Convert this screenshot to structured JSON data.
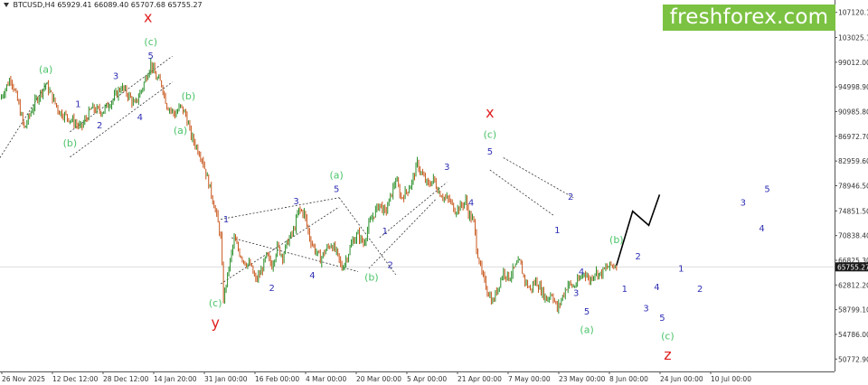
{
  "header": {
    "symbol": "BTCUSD,H4",
    "quote": "65929.41 66089.40 65707.68 65755.27"
  },
  "brand": {
    "name": "freshforex.com"
  },
  "colors": {
    "bull": "#2a8f2a",
    "bear": "#c8561b",
    "wave_minor": "#2f2fb5",
    "wave_intermediate": "#4cc46a",
    "wave_major": "#e02020",
    "current_price": "#1a1a1a",
    "forecast": "#000000"
  },
  "chart_data": {
    "type": "line",
    "title": "",
    "xlabel": "",
    "ylabel": "",
    "ylim": [
      48760,
      109130
    ],
    "y_ticks": [
      "107120.18",
      "103025.16",
      "99012.00",
      "94998.90",
      "90985.80",
      "86972.70",
      "82959.60",
      "78946.50",
      "74851.50",
      "70838.40",
      "66825.30",
      "62812.20",
      "58799.10",
      "54786.00",
      "50772.90"
    ],
    "current_price": "65755.27",
    "x_labels": [
      "26 Nov 2025",
      "12 Dec 12:00",
      "28 Dec 12:00",
      "14 Jan 20:00",
      "31 Jan 00:00",
      "16 Feb 00:00",
      "4 Mar 00:00",
      "20 Mar 00:00",
      "5 Apr 00:00",
      "21 Apr 00:00",
      "7 May 00:00",
      "23 May 00:00",
      "8 Jun 00:00",
      "24 Jun 00:00",
      "10 Jul 00:00"
    ],
    "series": [
      {
        "values": [
          [
            0,
            93000
          ],
          [
            4,
            96500
          ],
          [
            7,
            92000
          ],
          [
            9,
            88200
          ],
          [
            13,
            92500
          ],
          [
            17,
            95500
          ],
          [
            22,
            91000
          ],
          [
            27,
            89500
          ],
          [
            30,
            88300
          ],
          [
            34,
            91500
          ],
          [
            38,
            91000
          ],
          [
            42,
            93000
          ],
          [
            45,
            95000
          ],
          [
            48,
            93500
          ],
          [
            50,
            92000
          ],
          [
            53,
            95000
          ],
          [
            56,
            98800
          ],
          [
            58,
            96500
          ],
          [
            60,
            95500
          ],
          [
            62,
            92000
          ],
          [
            65,
            90500
          ],
          [
            67,
            91800
          ],
          [
            69,
            90500
          ],
          [
            71,
            87000
          ],
          [
            75,
            83500
          ],
          [
            78,
            78500
          ],
          [
            80,
            75000
          ],
          [
            82,
            70500
          ],
          [
            83,
            60500
          ],
          [
            85,
            65500
          ],
          [
            87,
            70300
          ],
          [
            89,
            68000
          ],
          [
            91,
            66500
          ],
          [
            93,
            66000
          ],
          [
            95,
            63500
          ],
          [
            97,
            65000
          ],
          [
            99,
            67500
          ],
          [
            101,
            66000
          ],
          [
            103,
            69000
          ],
          [
            105,
            67500
          ],
          [
            107,
            70000
          ],
          [
            109,
            71500
          ],
          [
            111,
            75000
          ],
          [
            113,
            74500
          ],
          [
            115,
            70500
          ],
          [
            117,
            68500
          ],
          [
            119,
            67000
          ],
          [
            121,
            68500
          ],
          [
            123,
            69500
          ],
          [
            125,
            68000
          ],
          [
            127,
            65500
          ],
          [
            129,
            67500
          ],
          [
            131,
            70000
          ],
          [
            133,
            71000
          ],
          [
            135,
            69500
          ],
          [
            137,
            72500
          ],
          [
            139,
            74500
          ],
          [
            141,
            76000
          ],
          [
            143,
            74500
          ],
          [
            145,
            77000
          ],
          [
            147,
            80000
          ],
          [
            149,
            77000
          ],
          [
            151,
            78000
          ],
          [
            153,
            79500
          ],
          [
            155,
            82500
          ],
          [
            157,
            80500
          ],
          [
            159,
            79000
          ],
          [
            161,
            80000
          ],
          [
            163,
            78000
          ],
          [
            165,
            77000
          ],
          [
            167,
            76500
          ],
          [
            169,
            75000
          ],
          [
            171,
            75500
          ],
          [
            173,
            76500
          ],
          [
            174,
            74500
          ],
          [
            176,
            73000
          ],
          [
            177,
            69000
          ],
          [
            179,
            64500
          ],
          [
            181,
            62000
          ],
          [
            183,
            60000
          ],
          [
            185,
            62500
          ],
          [
            187,
            65000
          ],
          [
            189,
            64000
          ],
          [
            191,
            65500
          ],
          [
            193,
            66500
          ],
          [
            195,
            63500
          ],
          [
            197,
            62000
          ],
          [
            199,
            63500
          ],
          [
            201,
            62000
          ],
          [
            203,
            60500
          ],
          [
            205,
            61500
          ],
          [
            207,
            58800
          ],
          [
            209,
            61000
          ],
          [
            211,
            63000
          ],
          [
            213,
            62500
          ],
          [
            215,
            63500
          ],
          [
            217,
            65000
          ],
          [
            219,
            63500
          ],
          [
            221,
            65000
          ],
          [
            223,
            64500
          ],
          [
            225,
            65500
          ],
          [
            227,
            66000
          ],
          [
            229,
            66000
          ]
        ]
      }
    ],
    "forecast": [
      [
        229,
        66000
      ],
      [
        235,
        74800
      ],
      [
        241,
        72500
      ],
      [
        245,
        77500
      ]
    ],
    "wave_labels": [
      {
        "t": "x",
        "x": 55,
        "y": 105500,
        "level": "major"
      },
      {
        "t": "(c)",
        "x": 56,
        "y": 101800,
        "level": "intermediate"
      },
      {
        "t": "5",
        "x": 56,
        "y": 99600,
        "level": "minor"
      },
      {
        "t": "(a)",
        "x": 17,
        "y": 97300,
        "level": "intermediate"
      },
      {
        "t": "1",
        "x": 29,
        "y": 91700,
        "level": "minor"
      },
      {
        "t": "2",
        "x": 37,
        "y": 88300,
        "level": "minor"
      },
      {
        "t": "3",
        "x": 43,
        "y": 96300,
        "level": "minor"
      },
      {
        "t": "4",
        "x": 52,
        "y": 89600,
        "level": "minor"
      },
      {
        "t": "(b)",
        "x": 26,
        "y": 85300,
        "level": "intermediate"
      },
      {
        "t": "(b)",
        "x": 70,
        "y": 93000,
        "level": "intermediate"
      },
      {
        "t": "(a)",
        "x": 67,
        "y": 87400,
        "level": "intermediate"
      },
      {
        "t": "(c)",
        "x": 80,
        "y": 59300,
        "level": "intermediate"
      },
      {
        "t": "y",
        "x": 80,
        "y": 55900,
        "level": "major"
      },
      {
        "t": "1",
        "x": 84,
        "y": 73000,
        "level": "minor"
      },
      {
        "t": "2",
        "x": 101,
        "y": 61800,
        "level": "minor"
      },
      {
        "t": "3",
        "x": 110,
        "y": 75900,
        "level": "minor"
      },
      {
        "t": "4",
        "x": 116,
        "y": 63900,
        "level": "minor"
      },
      {
        "t": "5",
        "x": 125,
        "y": 77900,
        "level": "minor"
      },
      {
        "t": "(a)",
        "x": 125,
        "y": 80100,
        "level": "intermediate"
      },
      {
        "t": "(b)",
        "x": 138,
        "y": 63500,
        "level": "intermediate"
      },
      {
        "t": "1",
        "x": 143,
        "y": 71100,
        "level": "minor"
      },
      {
        "t": "2",
        "x": 145,
        "y": 65600,
        "level": "minor"
      },
      {
        "t": "3",
        "x": 166,
        "y": 81500,
        "level": "minor"
      },
      {
        "t": "4",
        "x": 175,
        "y": 75700,
        "level": "minor"
      },
      {
        "t": "5",
        "x": 182,
        "y": 84000,
        "level": "minor"
      },
      {
        "t": "(c)",
        "x": 182,
        "y": 86700,
        "level": "intermediate"
      },
      {
        "t": "x",
        "x": 182,
        "y": 90000,
        "level": "major"
      },
      {
        "t": "2",
        "x": 212,
        "y": 76700,
        "level": "minor"
      },
      {
        "t": "1",
        "x": 207,
        "y": 71200,
        "level": "minor"
      },
      {
        "t": "(b)",
        "x": 229,
        "y": 69600,
        "level": "intermediate"
      },
      {
        "t": "2",
        "x": 237,
        "y": 67000,
        "level": "minor"
      },
      {
        "t": "4",
        "x": 216,
        "y": 64500,
        "level": "minor"
      },
      {
        "t": "3",
        "x": 214,
        "y": 61000,
        "level": "minor"
      },
      {
        "t": "1",
        "x": 232,
        "y": 61700,
        "level": "minor"
      },
      {
        "t": "5",
        "x": 218,
        "y": 58000,
        "level": "minor"
      },
      {
        "t": "(a)",
        "x": 218,
        "y": 55000,
        "level": "intermediate"
      },
      {
        "t": "1",
        "x": 253,
        "y": 65000,
        "level": "minor"
      },
      {
        "t": "4",
        "x": 244,
        "y": 62000,
        "level": "minor"
      },
      {
        "t": "3",
        "x": 240,
        "y": 58500,
        "level": "minor"
      },
      {
        "t": "2",
        "x": 260,
        "y": 61700,
        "level": "minor"
      },
      {
        "t": "5",
        "x": 246,
        "y": 57000,
        "level": "minor"
      },
      {
        "t": "(c)",
        "x": 248,
        "y": 54000,
        "level": "intermediate"
      },
      {
        "t": "z",
        "x": 248,
        "y": 50700,
        "level": "major"
      },
      {
        "t": "3",
        "x": 276,
        "y": 75700,
        "level": "minor"
      },
      {
        "t": "4",
        "x": 283,
        "y": 71500,
        "level": "minor"
      },
      {
        "t": "5",
        "x": 285,
        "y": 77900,
        "level": "minor"
      }
    ],
    "channels": [
      [
        [
          0,
          83500
        ],
        [
          18,
          96000
        ]
      ],
      [
        [
          26,
          87700
        ],
        [
          64,
          100000
        ]
      ],
      [
        [
          26,
          83600
        ],
        [
          64,
          95800
        ]
      ],
      [
        [
          82,
          63000
        ],
        [
          126,
          75500
        ]
      ],
      [
        [
          82,
          73500
        ],
        [
          126,
          77000
        ]
      ],
      [
        [
          86,
          70500
        ],
        [
          133,
          65000
        ]
      ],
      [
        [
          126,
          77000
        ],
        [
          147,
          64500
        ]
      ],
      [
        [
          141,
          70500
        ],
        [
          166,
          79500
        ]
      ],
      [
        [
          137,
          65500
        ],
        [
          162,
          76800
        ]
      ],
      [
        [
          187,
          83500
        ],
        [
          213,
          77000
        ]
      ],
      [
        [
          182,
          81500
        ],
        [
          206,
          74000
        ]
      ]
    ],
    "x_max": 310,
    "grid": false,
    "legend": "none"
  }
}
